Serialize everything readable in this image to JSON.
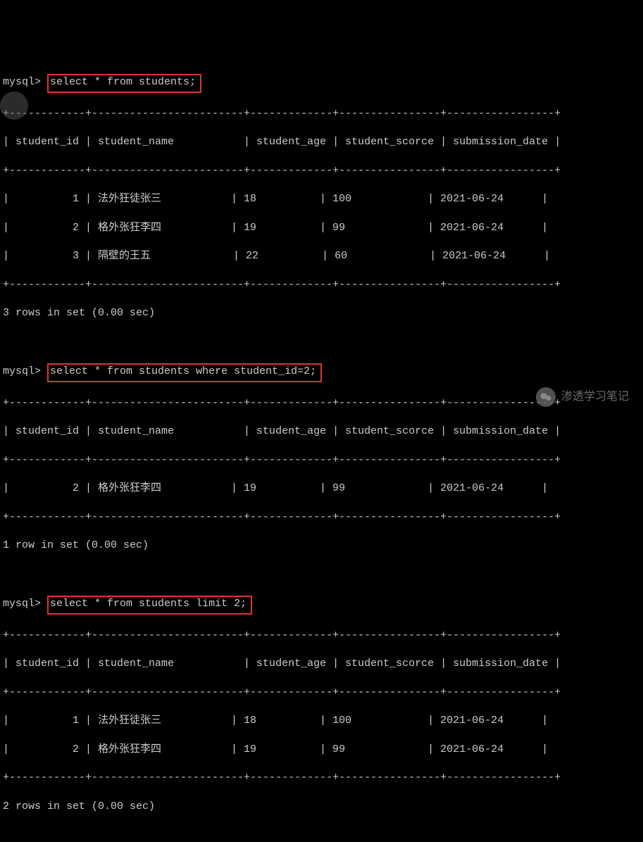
{
  "prompt": "mysql>",
  "queries": {
    "q1": "select * from students;",
    "q2": "select * from students where student_id=2;",
    "q3": "select * from students limit 2;"
  },
  "chart_data": [
    {
      "type": "table",
      "title": "select * from students;",
      "columns": [
        "student_id",
        "student_name",
        "student_age",
        "student_scorce",
        "submission_date"
      ],
      "rows": [
        {
          "student_id": "1",
          "student_name": "法外狂徒张三",
          "student_age": "18",
          "student_scorce": "100",
          "submission_date": "2021-06-24"
        },
        {
          "student_id": "2",
          "student_name": "格外张狂李四",
          "student_age": "19",
          "student_scorce": "99",
          "submission_date": "2021-06-24"
        },
        {
          "student_id": "3",
          "student_name": "隔壁的王五",
          "student_age": "22",
          "student_scorce": "60",
          "submission_date": "2021-06-24"
        }
      ],
      "footer": "3 rows in set (0.00 sec)"
    },
    {
      "type": "table",
      "title": "select * from students where student_id=2;",
      "columns": [
        "student_id",
        "student_name",
        "student_age",
        "student_scorce",
        "submission_date"
      ],
      "rows": [
        {
          "student_id": "2",
          "student_name": "格外张狂李四",
          "student_age": "19",
          "student_scorce": "99",
          "submission_date": "2021-06-24"
        }
      ],
      "footer": "1 row in set (0.00 sec)"
    },
    {
      "type": "table",
      "title": "select * from students limit 2;",
      "columns": [
        "student_id",
        "student_name",
        "student_age",
        "student_scorce",
        "submission_date"
      ],
      "rows": [
        {
          "student_id": "1",
          "student_name": "法外狂徒张三",
          "student_age": "18",
          "student_scorce": "100",
          "submission_date": "2021-06-24"
        },
        {
          "student_id": "2",
          "student_name": "格外张狂李四",
          "student_age": "19",
          "student_scorce": "99",
          "submission_date": "2021-06-24"
        }
      ],
      "footer": "2 rows in set (0.00 sec)"
    }
  ],
  "borders": {
    "sep": "+------------+------------------------+-------------+----------------+-----------------+",
    "header": "| student_id | student_name           | student_age | student_scorce | submission_date |"
  },
  "rows_fmt": {
    "t1r1": "|          1 | 法外狂徒张三           | 18          | 100            | 2021-06-24      |",
    "t1r2": "|          2 | 格外张狂李四           | 19          | 99             | 2021-06-24      |",
    "t1r3": "|          3 | 隔壁的王五             | 22          | 60             | 2021-06-24      |",
    "t2r1": "|          2 | 格外张狂李四           | 19          | 99             | 2021-06-24      |",
    "t3r1": "|          1 | 法外狂徒张三           | 18          | 100            | 2021-06-24      |",
    "t3r2": "|          2 | 格外张狂李四           | 19          | 99             | 2021-06-24      |"
  },
  "footers": {
    "f1": "3 rows in set (0.00 sec)",
    "f2": "1 row in set (0.00 sec)",
    "f3": "2 rows in set (0.00 sec)"
  },
  "watermark": "渗透学习笔记"
}
